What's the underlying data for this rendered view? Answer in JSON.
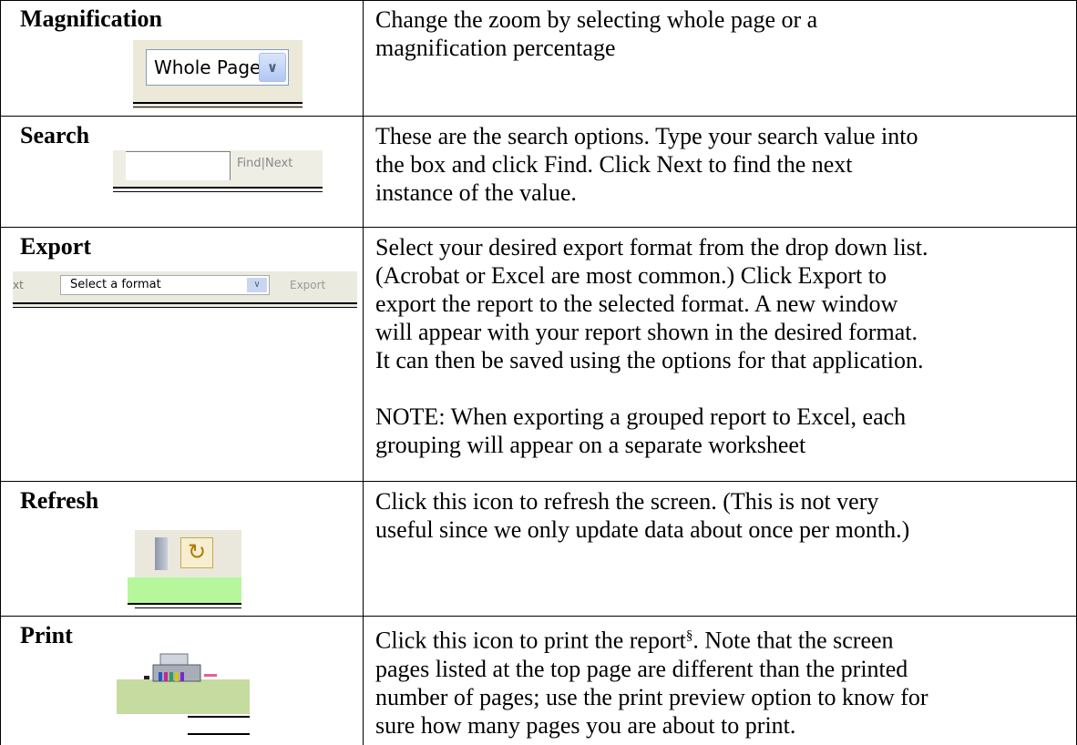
{
  "rows": [
    {
      "title": "Magnification",
      "description": "Change the zoom by selecting whole page or a\nmagnification percentage",
      "control": {
        "select_value": "Whole Page",
        "arrow_icon": "chevron-down-icon"
      }
    },
    {
      "title": "Search",
      "description": "These are the search options.  Type your search value into\nthe box and click Find.  Click Next to find the next\ninstance of the value.",
      "control": {
        "find_next_label": "Find|Next"
      }
    },
    {
      "title": "Export",
      "description": "Select your desired export format from the drop down list.\n(Acrobat or Excel are most common.)  Click Export to\nexport the report to the selected format.  A new window\nwill appear with your report shown in the desired format.\nIt can then be saved using the options for that application.\n\nNOTE: When exporting a grouped report to Excel, each\ngrouping will appear on a separate worksheet",
      "control": {
        "prev_label": "xt",
        "select_value": "Select a format",
        "export_label": "Export"
      }
    },
    {
      "title": "Refresh",
      "description": "Click this icon to refresh the screen.  (This is not very\nuseful since we only update data about once per month.)",
      "control": {
        "icon": "refresh-icon"
      }
    },
    {
      "title": "Print",
      "description_before": "Click this icon to print the report",
      "footnote_mark": "§",
      "description_after": ".  Note that the screen\npages listed at the top page are different than the printed\nnumber of pages; use the print preview option to know for\nsure how many pages you are about to print.",
      "control": {
        "icon": "printer-icon"
      }
    }
  ],
  "colors": {
    "ui_gray": "#ece9d8",
    "select_border": "#7f9db9",
    "refresh_green": "#b6f79c"
  }
}
